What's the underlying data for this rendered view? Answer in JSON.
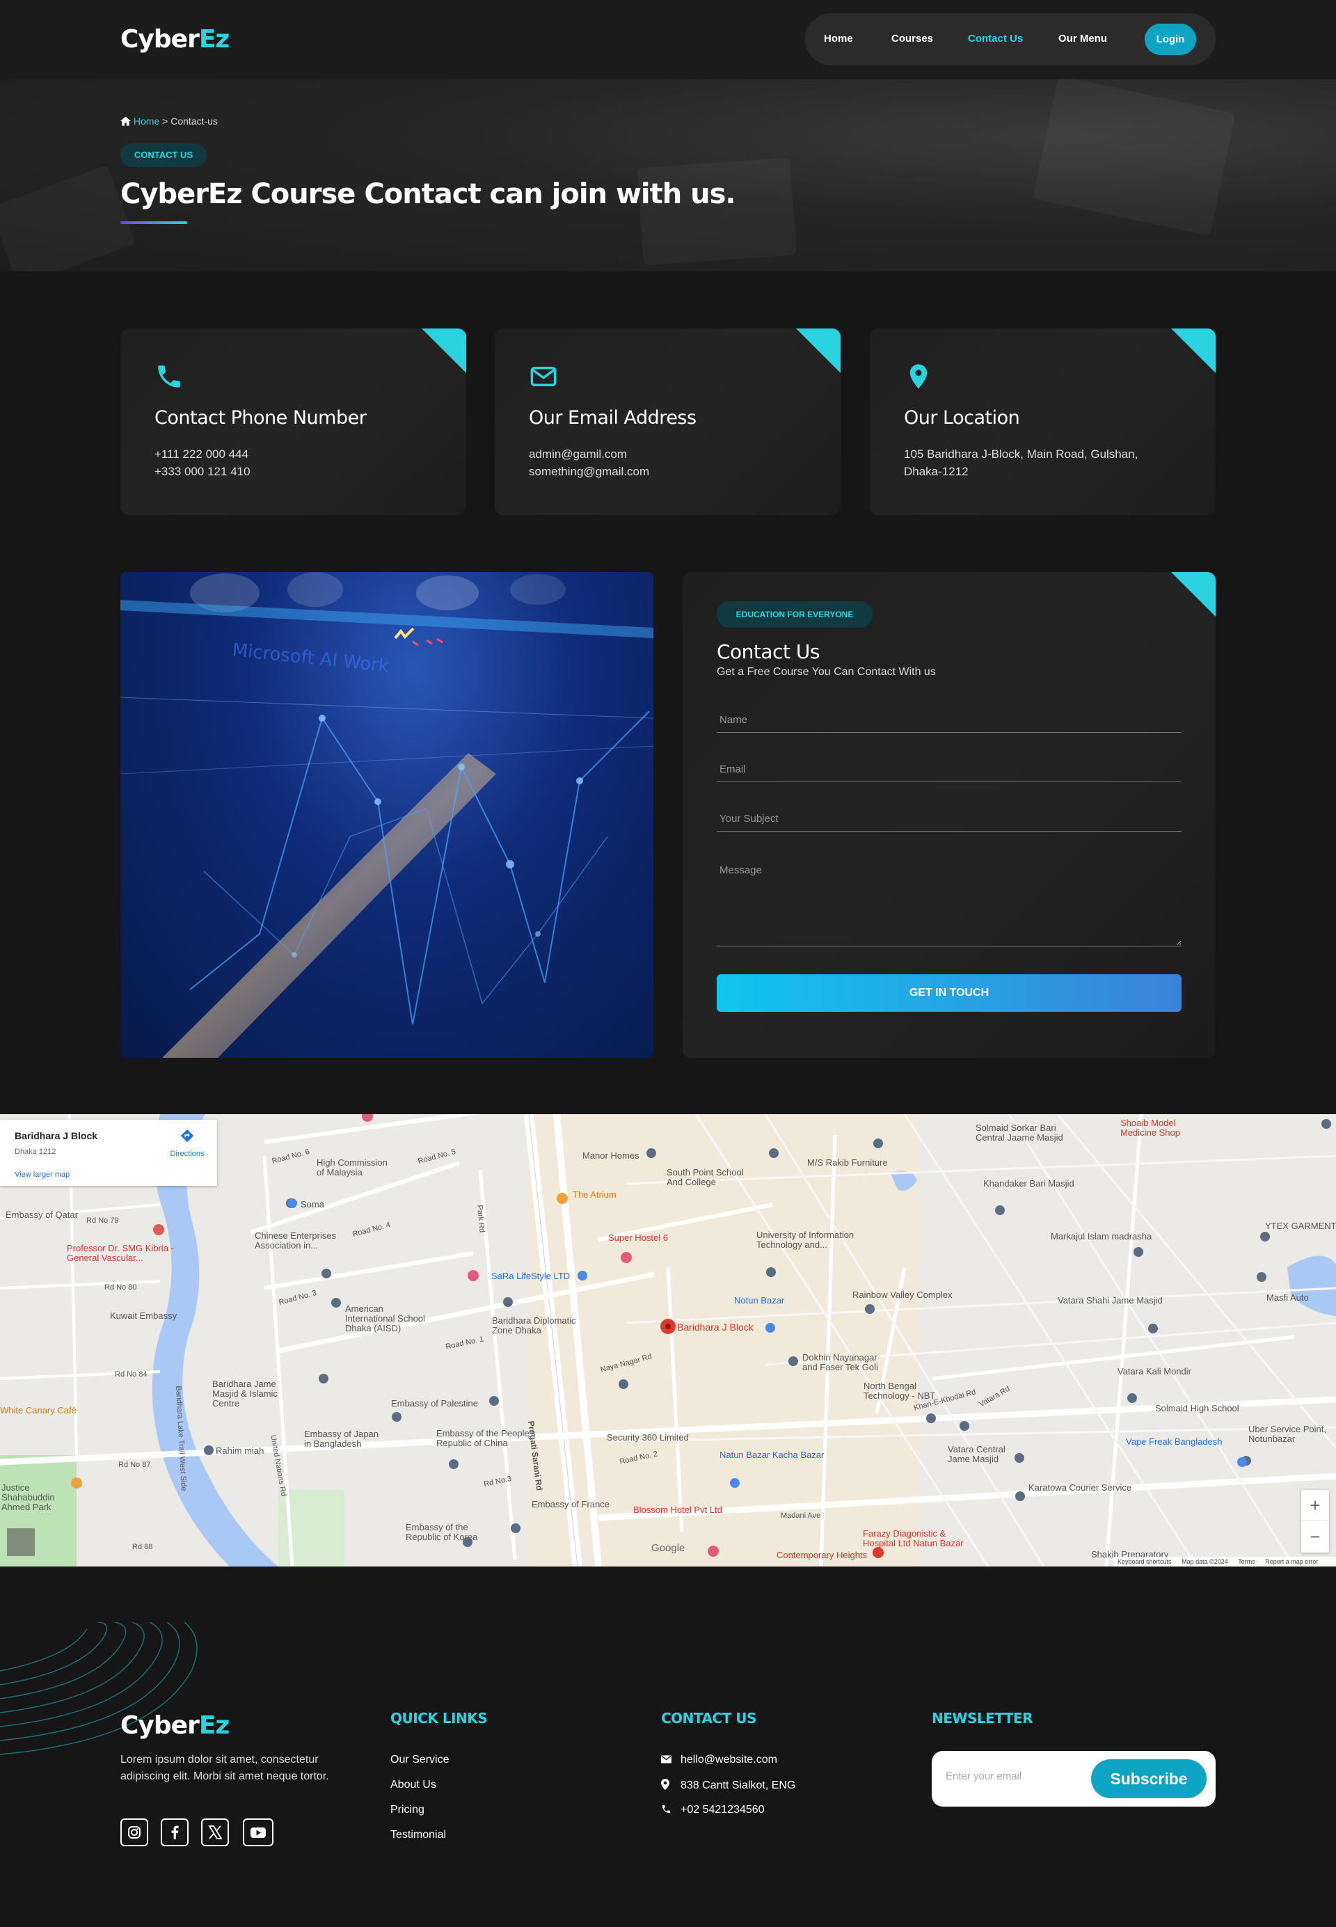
{
  "header": {
    "logo_part1": "Cyber",
    "logo_part2": "Ez",
    "nav": [
      "Home",
      "Courses",
      "Contact Us",
      "Our Menu"
    ],
    "login": "Login"
  },
  "hero": {
    "breadcrumb_home": "Home",
    "breadcrumb_sep": ">",
    "breadcrumb_current": "Contact-us",
    "badge": "CONTACT US",
    "title": "CyberEz Course Contact can join with us."
  },
  "info_cards": [
    {
      "title": "Contact Phone Number",
      "lines": [
        "+111 222 000 444",
        "+333 000 121 410"
      ]
    },
    {
      "title": "Our Email Address",
      "lines": [
        "admin@gamil.com",
        "something@gmail.com"
      ]
    },
    {
      "title": "Our Location",
      "lines": [
        "105 Baridhara J-Block, Main Road, Gulshan,",
        "Dhaka-1212"
      ]
    }
  ],
  "form": {
    "badge": "EDUCATION FOR EVERYONE",
    "title": "Contact Us",
    "subtitle": "Get a Free Course You Can Contact With us",
    "name_placeholder": "Name",
    "email_placeholder": "Email",
    "subject_placeholder": "Your Subject",
    "message_placeholder": "Message",
    "submit": "GET IN TOUCH"
  },
  "photo": {
    "overlay_text": "Microsoft AI Work"
  },
  "map": {
    "place_name": "Baridhara J Block",
    "place_sub": "Dhaka 1212",
    "larger_map": "View larger map",
    "directions": "Directions",
    "pin_label": "Baridhara J Block",
    "labels": [
      "High Commission of Malaysia",
      "Manor Homes",
      "South Point School And College",
      "M/S Rakib Furniture",
      "Solmaid Sorkar Bari Central Jaame Masjid",
      "Shoaib Model Medicine Shop",
      "Khandaker Bari Masjid",
      "Soma",
      "The Atrium",
      "Embassy of Qatar",
      "Professor Dr. SMG Kibria - General Vascular...",
      "Chinese Enterprises Association in...",
      "Super Hostel 6",
      "University of Information Technology and...",
      "Markajul Islam madrasha",
      "YTEX GARMENT",
      "SaRa LifeStyle LTD",
      "Rainbow Valley Complex",
      "Vatara Shahi Jame Masjid",
      "Masfi Auto",
      "Kuwait Embassy",
      "American International School Dhaka (AISD)",
      "Baridhara Diplomatic Zone Dhaka",
      "Notun Bazar",
      "Dokhin Nayanagar and Faser Tek Goli",
      "Vatara Kali Mondir",
      "Baridhara Jame Masjid & Islamic Centre",
      "Embassy of Palestine",
      "North Bengal Technology - NBT",
      "Solmaid High School",
      "White Canary Café",
      "Embassy of Japan in Bangladesh",
      "Embassy of the People's Republic of China",
      "Security 360 Limited",
      "Vatara Central Jame Masjid",
      "Vape Freak Bangladesh",
      "Uber Service Point, Notunbazar",
      "Rahim miah",
      "Natun Bazar Kacha Bazar",
      "Karatowa Courier Service",
      "Embassy of France",
      "Blossom Hotel Pvt Ltd",
      "Embassy of the Republic of Korea",
      "Farazy Diagonistic & Hospital Ltd Natun Bazar",
      "Contemporary Heights",
      "Shakib Preparatory",
      "Justice Shahabuddin Ahmed Park",
      "Road No. 6",
      "Road No. 5",
      "Road No. 4",
      "Rd No 79",
      "Rd No 80",
      "Rd No 84",
      "Rd No 87",
      "Rd 88",
      "Road No. 3",
      "Road No. 1",
      "Road No. 2",
      "Rd No.3",
      "Madani Ave",
      "Naya Nagar Rd",
      "Progati Sarani Rd",
      "Baridhara Lake Trail West Side",
      "United Nations Rd",
      "Park Rd",
      "Khan-E-Khodai Rd",
      "Vatara Rd"
    ],
    "google": "Google",
    "footer_bar": [
      "Keyboard shortcuts",
      "Map data ©2024",
      "Terms",
      "Report a map error"
    ],
    "zoom_in": "+",
    "zoom_out": "−"
  },
  "footer": {
    "logo_part1": "Cyber",
    "logo_part2": "Ez",
    "about": "Lorem ipsum dolor sit amet, consectetur adipiscing elit. Morbi sit amet neque tortor.",
    "quick_links_title": "QUICK LINKS",
    "quick_links": [
      "Our Service",
      "About Us",
      "Pricing",
      "Testimonial"
    ],
    "contact_title": "CONTACT US",
    "contact": [
      "hello@website.com",
      "838 Cantt Sialkot, ENG",
      "+02 5421234560"
    ],
    "newsletter_title": "NEWSLETTER",
    "newsletter_placeholder": "Enter your email",
    "subscribe": "Subscribe"
  },
  "colors": {
    "accent": "#2ad3e0",
    "button": "#0ea5c4",
    "background": "#161616",
    "card": "#202020"
  },
  "icons": [
    "phone-icon",
    "mail-icon",
    "location-pin-icon",
    "home-icon",
    "instagram-icon",
    "facebook-icon",
    "x-icon",
    "youtube-icon"
  ]
}
